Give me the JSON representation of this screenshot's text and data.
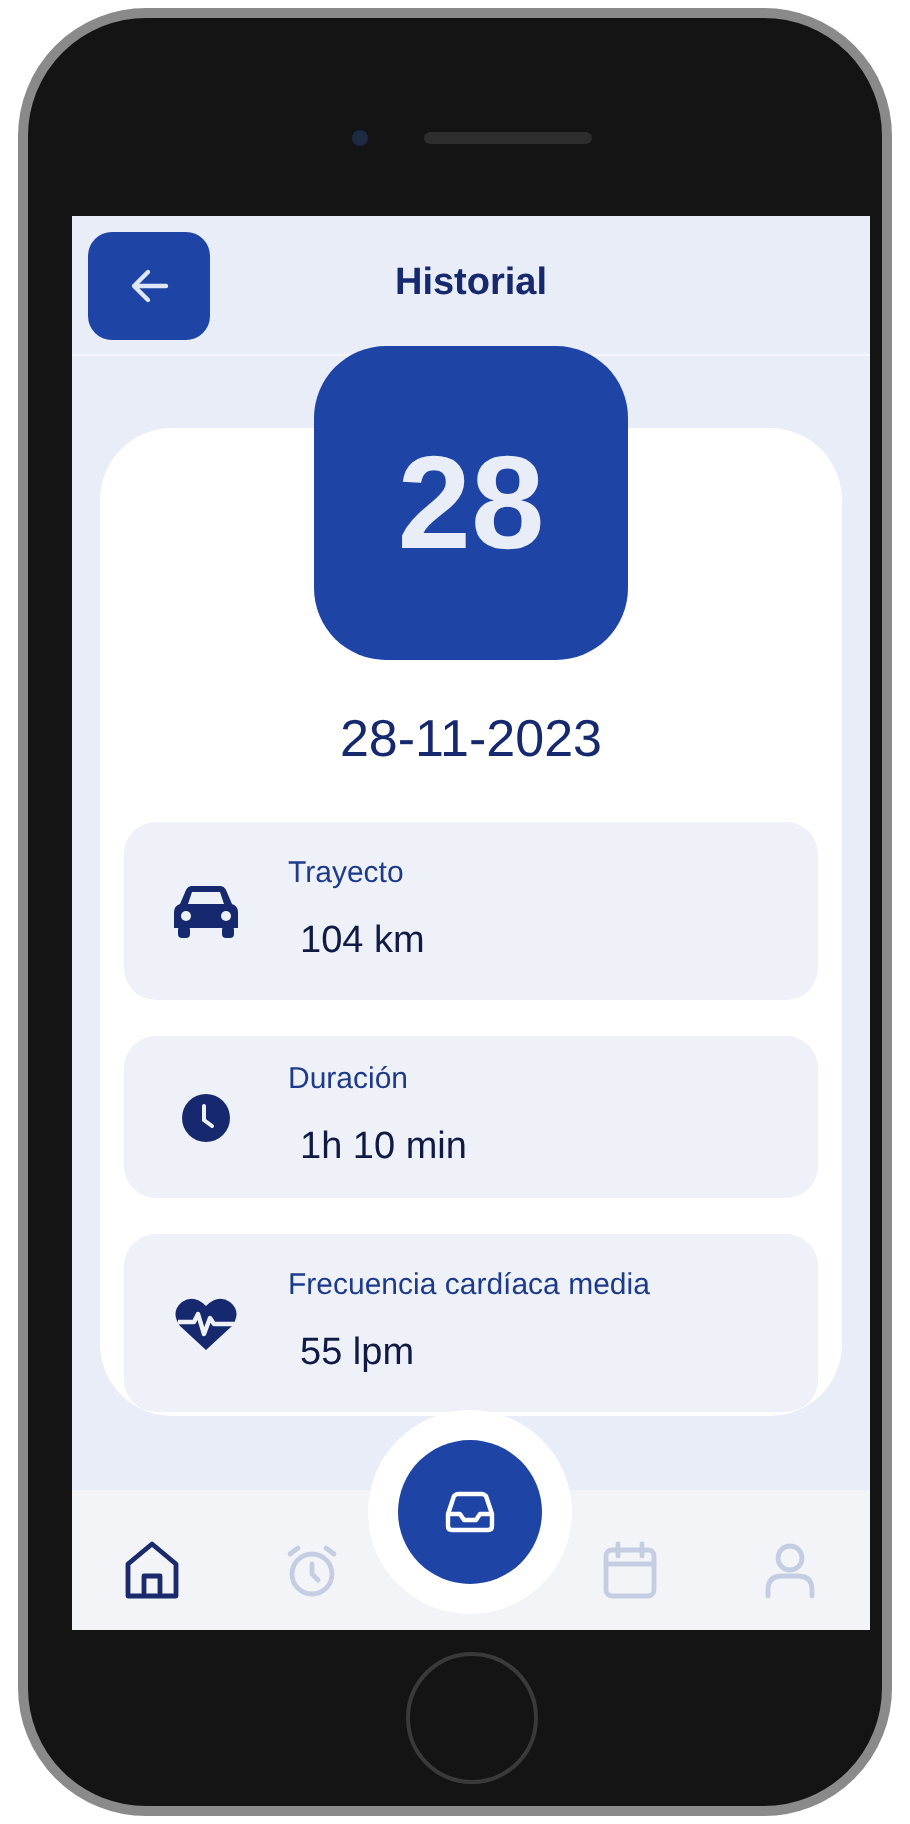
{
  "header": {
    "title": "Historial"
  },
  "day_badge": "28",
  "date": "28-11-2023",
  "stats": [
    {
      "kind": "car",
      "label": "Trayecto",
      "value": "104 km"
    },
    {
      "kind": "clock",
      "label": "Duración",
      "value": "1h 10 min"
    },
    {
      "kind": "heart",
      "label": "Frecuencia cardíaca media",
      "value": "55 lpm"
    }
  ],
  "nav": [
    {
      "kind": "home",
      "selected": true
    },
    {
      "kind": "alarm",
      "selected": false
    },
    {
      "kind": "inbox",
      "selected": false
    },
    {
      "kind": "calendar",
      "selected": false
    },
    {
      "kind": "profile",
      "selected": false
    }
  ]
}
